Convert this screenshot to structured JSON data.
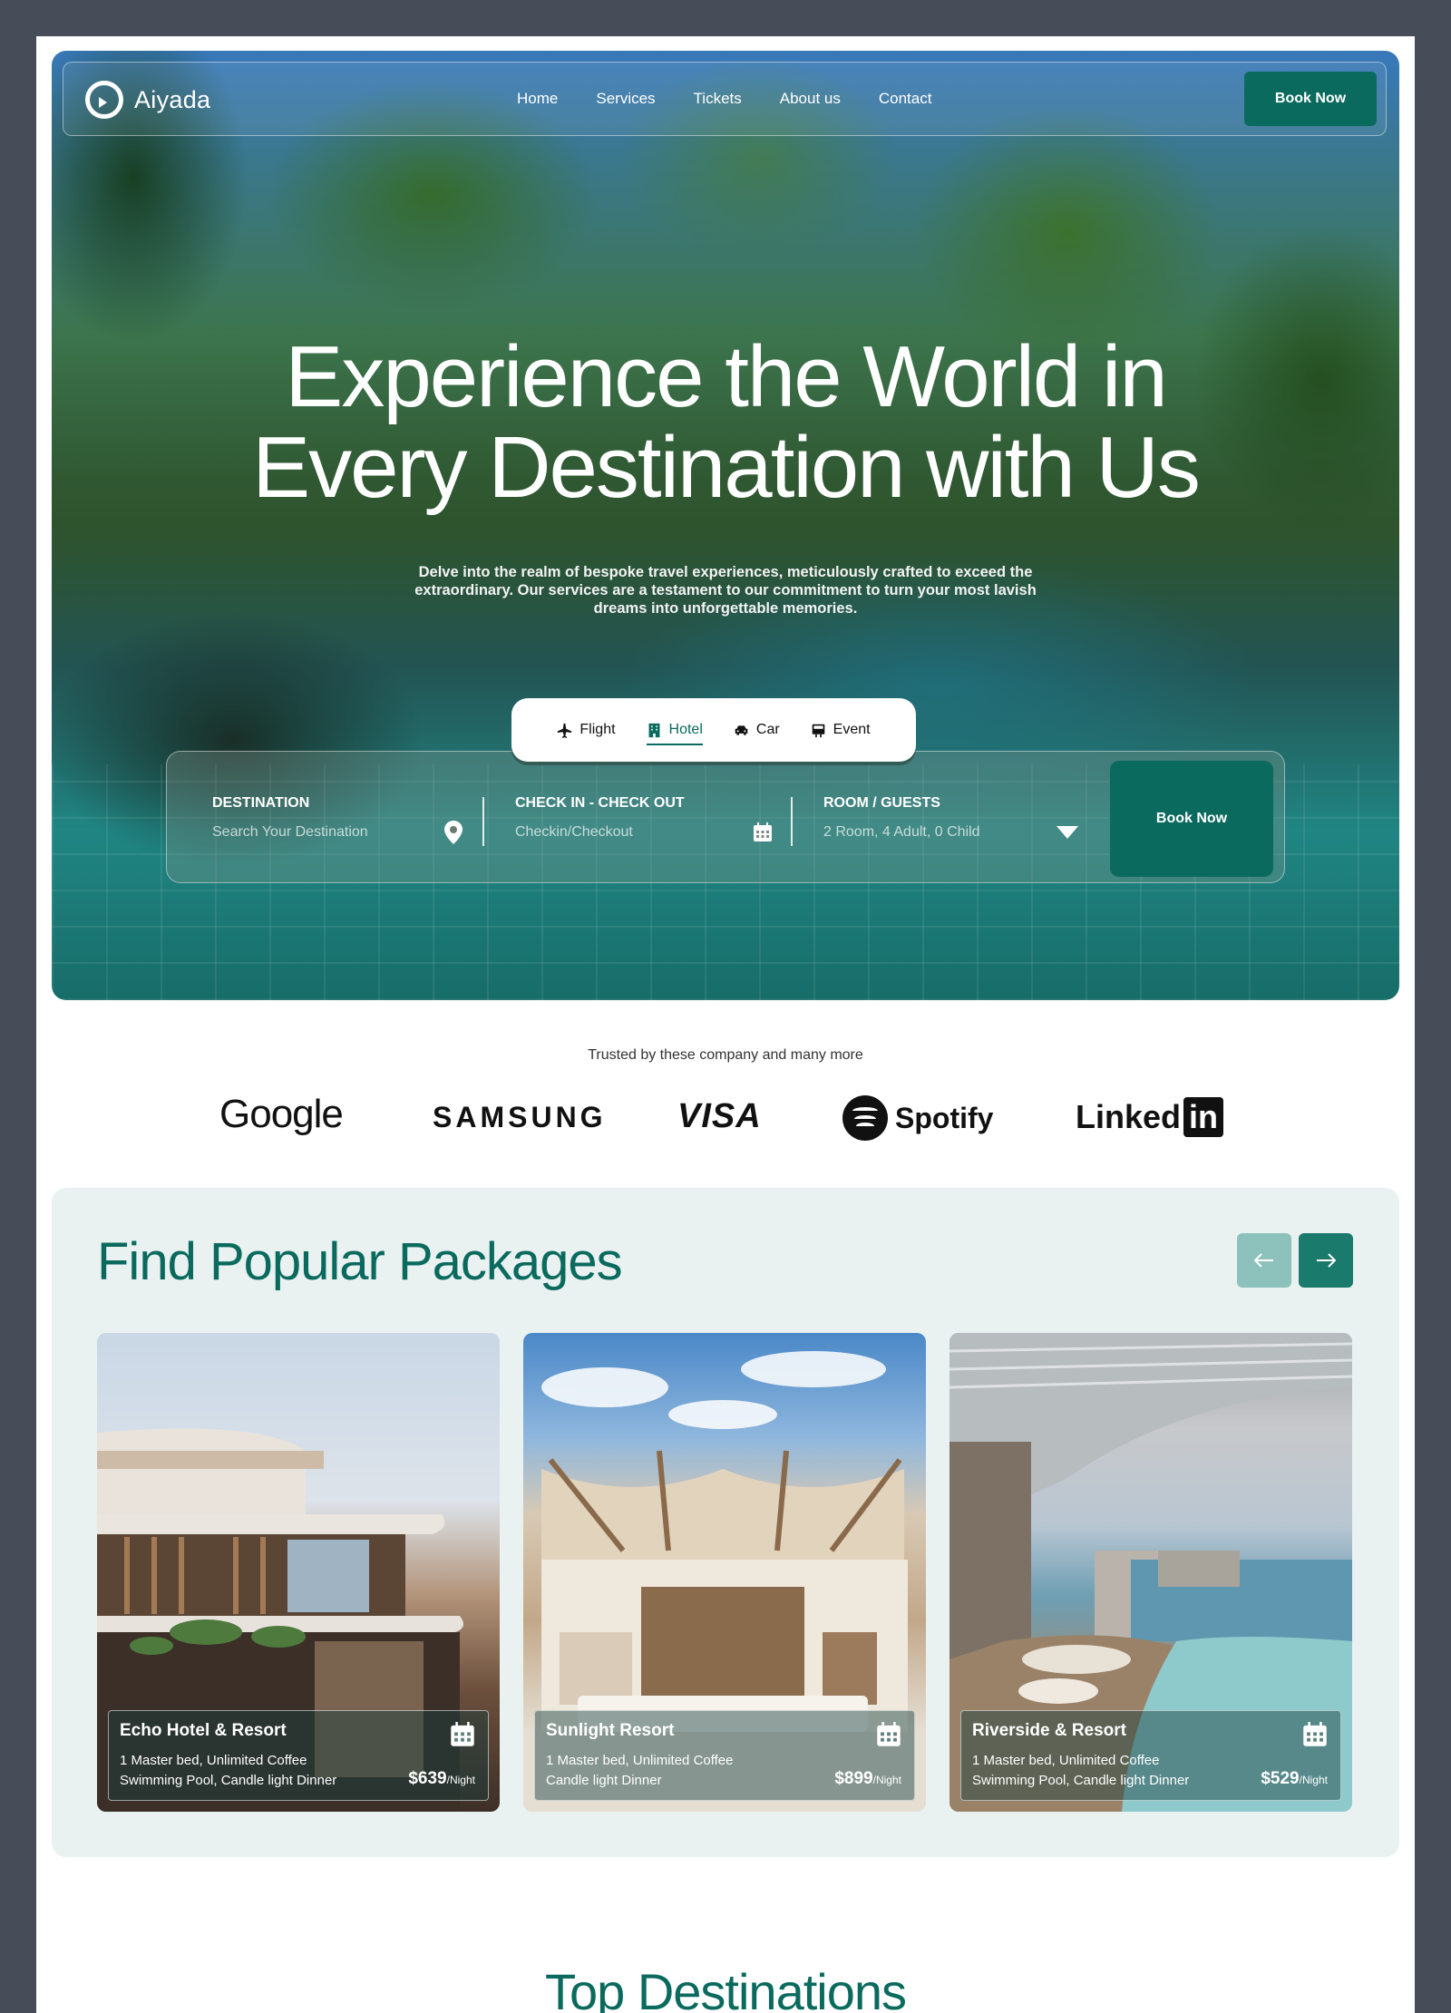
{
  "brand": {
    "name": "Aiyada"
  },
  "nav": {
    "links": [
      "Home",
      "Services",
      "Tickets",
      "About us",
      "Contact"
    ],
    "cta": "Book Now"
  },
  "hero": {
    "title_line1": "Experience the World in",
    "title_line2": "Every Destination with Us",
    "description": "Delve into the realm of bespoke travel experiences, meticulously crafted to exceed the extraordinary. Our services are a testament to our commitment to turn your most lavish dreams into unforgettable memories."
  },
  "booking": {
    "tabs": [
      {
        "label": "Flight",
        "icon": "plane-icon",
        "active": false
      },
      {
        "label": "Hotel",
        "icon": "building-icon",
        "active": true
      },
      {
        "label": "Car",
        "icon": "car-icon",
        "active": false
      },
      {
        "label": "Event",
        "icon": "event-icon",
        "active": false
      }
    ],
    "destination": {
      "label": "DESTINATION",
      "placeholder": "Search Your Destination",
      "icon": "location-pin-icon"
    },
    "dates": {
      "label": "CHECK IN - CHECK OUT",
      "placeholder": "Checkin/Checkout",
      "icon": "calendar-icon"
    },
    "guests": {
      "label": "ROOM / GUESTS",
      "value": "2 Room, 4 Adult, 0 Child",
      "icon": "chevron-down-icon"
    },
    "cta": "Book Now"
  },
  "trusted": {
    "text": "Trusted by these company and many more",
    "logos": [
      "Google",
      "SAMSUNG",
      "VISA",
      "Spotify",
      "Linked",
      "in"
    ]
  },
  "packages": {
    "title": "Find Popular Packages",
    "prev_icon": "arrow-left-icon",
    "next_icon": "arrow-right-icon",
    "cards": [
      {
        "name": "Echo Hotel & Resort",
        "desc1": "1 Master bed, Unlimited Coffee",
        "desc2": "Swimming Pool, Candle light Dinner",
        "price": "$639",
        "unit": "/Night"
      },
      {
        "name": "Sunlight Resort",
        "desc1": "1 Master bed, Unlimited Coffee",
        "desc2": "Candle light Dinner",
        "price": "$899",
        "unit": "/Night"
      },
      {
        "name": "Riverside & Resort",
        "desc1": "1 Master bed, Unlimited Coffee",
        "desc2": "Swimming Pool, Candle light Dinner",
        "price": "$529",
        "unit": "/Night"
      }
    ]
  },
  "destinations": {
    "title": "Top Destinations"
  },
  "colors": {
    "accent": "#0b6a5e",
    "accent_light": "#8dc1bb",
    "packages_bg": "#eaf2f1",
    "frame": "#464c58"
  }
}
